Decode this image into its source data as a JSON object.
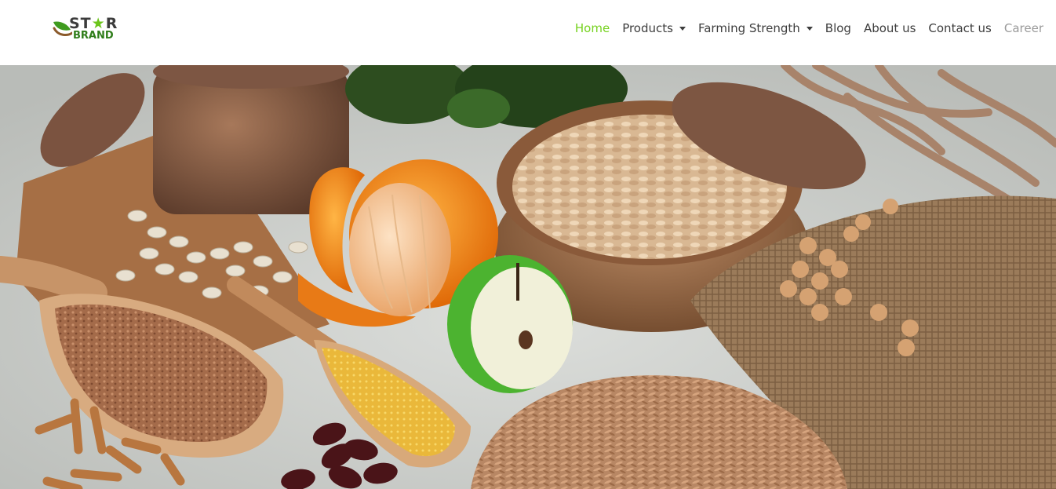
{
  "logo": {
    "top_text_prefix": "ST",
    "top_text_star": "★",
    "top_text_suffix": "R",
    "bottom_text": "BRAND",
    "colors": {
      "leaf": "#3f9b1f",
      "star": "#6cc51b",
      "text": "#3c3c3c"
    }
  },
  "nav": {
    "items": [
      {
        "label": "Home",
        "state": "active",
        "dropdown": false
      },
      {
        "label": "Products",
        "state": "normal",
        "dropdown": true
      },
      {
        "label": "Farming Strength",
        "state": "normal",
        "dropdown": true
      },
      {
        "label": "Blog",
        "state": "normal",
        "dropdown": false
      },
      {
        "label": "About us",
        "state": "normal",
        "dropdown": false
      },
      {
        "label": "Contact us",
        "state": "normal",
        "dropdown": false
      },
      {
        "label": "Career",
        "state": "muted",
        "dropdown": false
      }
    ],
    "colors": {
      "active": "#76d21f",
      "normal": "#3d3d3d",
      "muted": "#9a9a9a"
    }
  },
  "hero": {
    "image_subject": "grains-beans-fruit-still-life"
  }
}
